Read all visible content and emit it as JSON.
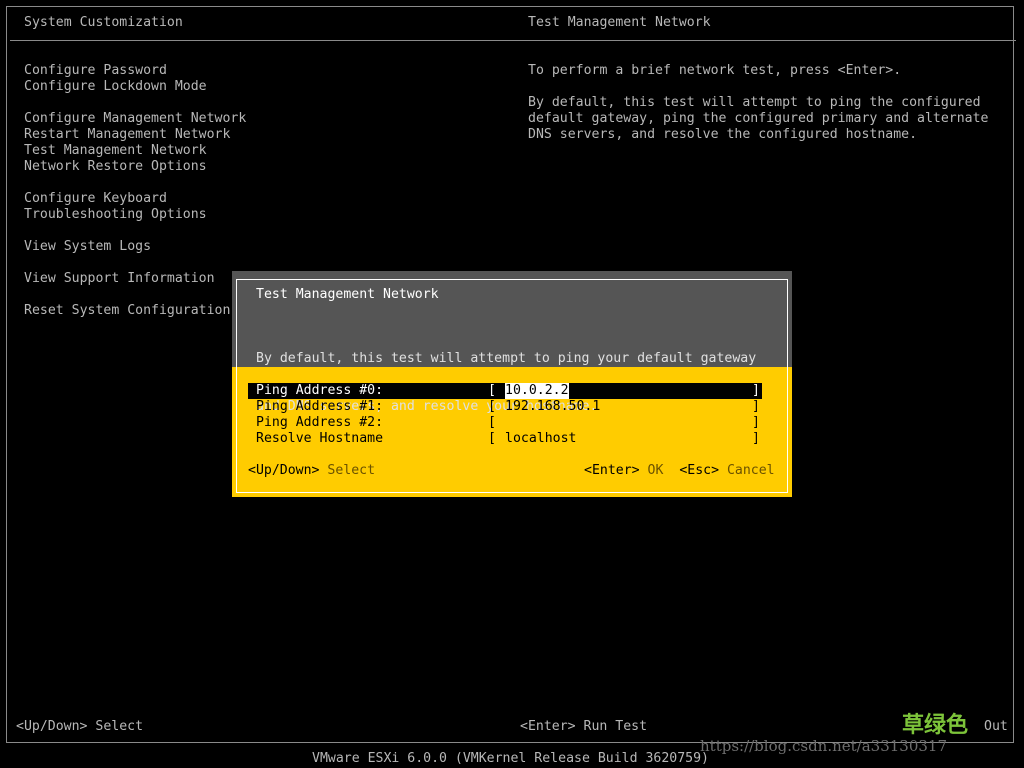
{
  "header": {
    "left_title": "System Customization",
    "right_title": "Test Management Network"
  },
  "menu": {
    "groups": [
      [
        "Configure Password",
        "Configure Lockdown Mode"
      ],
      [
        "Configure Management Network",
        "Restart Management Network",
        "Test Management Network",
        "Network Restore Options"
      ],
      [
        "Configure Keyboard",
        "Troubleshooting Options"
      ],
      [
        "View System Logs"
      ],
      [
        "View Support Information"
      ],
      [
        "Reset System Configuration"
      ]
    ]
  },
  "info": {
    "para1": "To perform a brief network test, press <Enter>.",
    "para2_lines": [
      "By default, this test will attempt to ping the configured",
      "default gateway, ping the configured primary and alternate",
      "DNS servers, and resolve the configured hostname."
    ]
  },
  "dialog": {
    "title": "Test Management Network",
    "desc_lines": [
      "By default, this test will attempt to ping your default gateway",
      "and DNS servers, and resolve your hostname."
    ],
    "fields": [
      {
        "label": "Ping Address #0:",
        "value": "10.0.2.2",
        "selected": true
      },
      {
        "label": "Ping Address #1:",
        "value": "192.168.50.1",
        "selected": false
      },
      {
        "label": "Ping Address #2:",
        "value": "",
        "selected": false
      },
      {
        "label": "Resolve Hostname",
        "value": "localhost",
        "selected": false
      }
    ],
    "bracket_left": "[",
    "bracket_right": "]",
    "hint_updown_key": "<Up/Down>",
    "hint_updown_action": "Select",
    "hint_enter_key": "<Enter>",
    "hint_enter_action": "OK",
    "hint_esc_key": "<Esc>",
    "hint_esc_action": "Cancel"
  },
  "footer": {
    "left": "<Up/Down> Select",
    "center": "<Enter> Run Test",
    "right": "Out",
    "status": "VMware ESXi 6.0.0 (VMKernel Release Build 3620759)"
  },
  "watermark": {
    "url_text": "https://blog.csdn.net/a33130317",
    "stamp_text": "草绿色"
  },
  "colors": {
    "background": "#000000",
    "text": "#b8b8b8",
    "dialog_yellow": "#ffcc00",
    "dialog_header_gray": "#555555"
  }
}
